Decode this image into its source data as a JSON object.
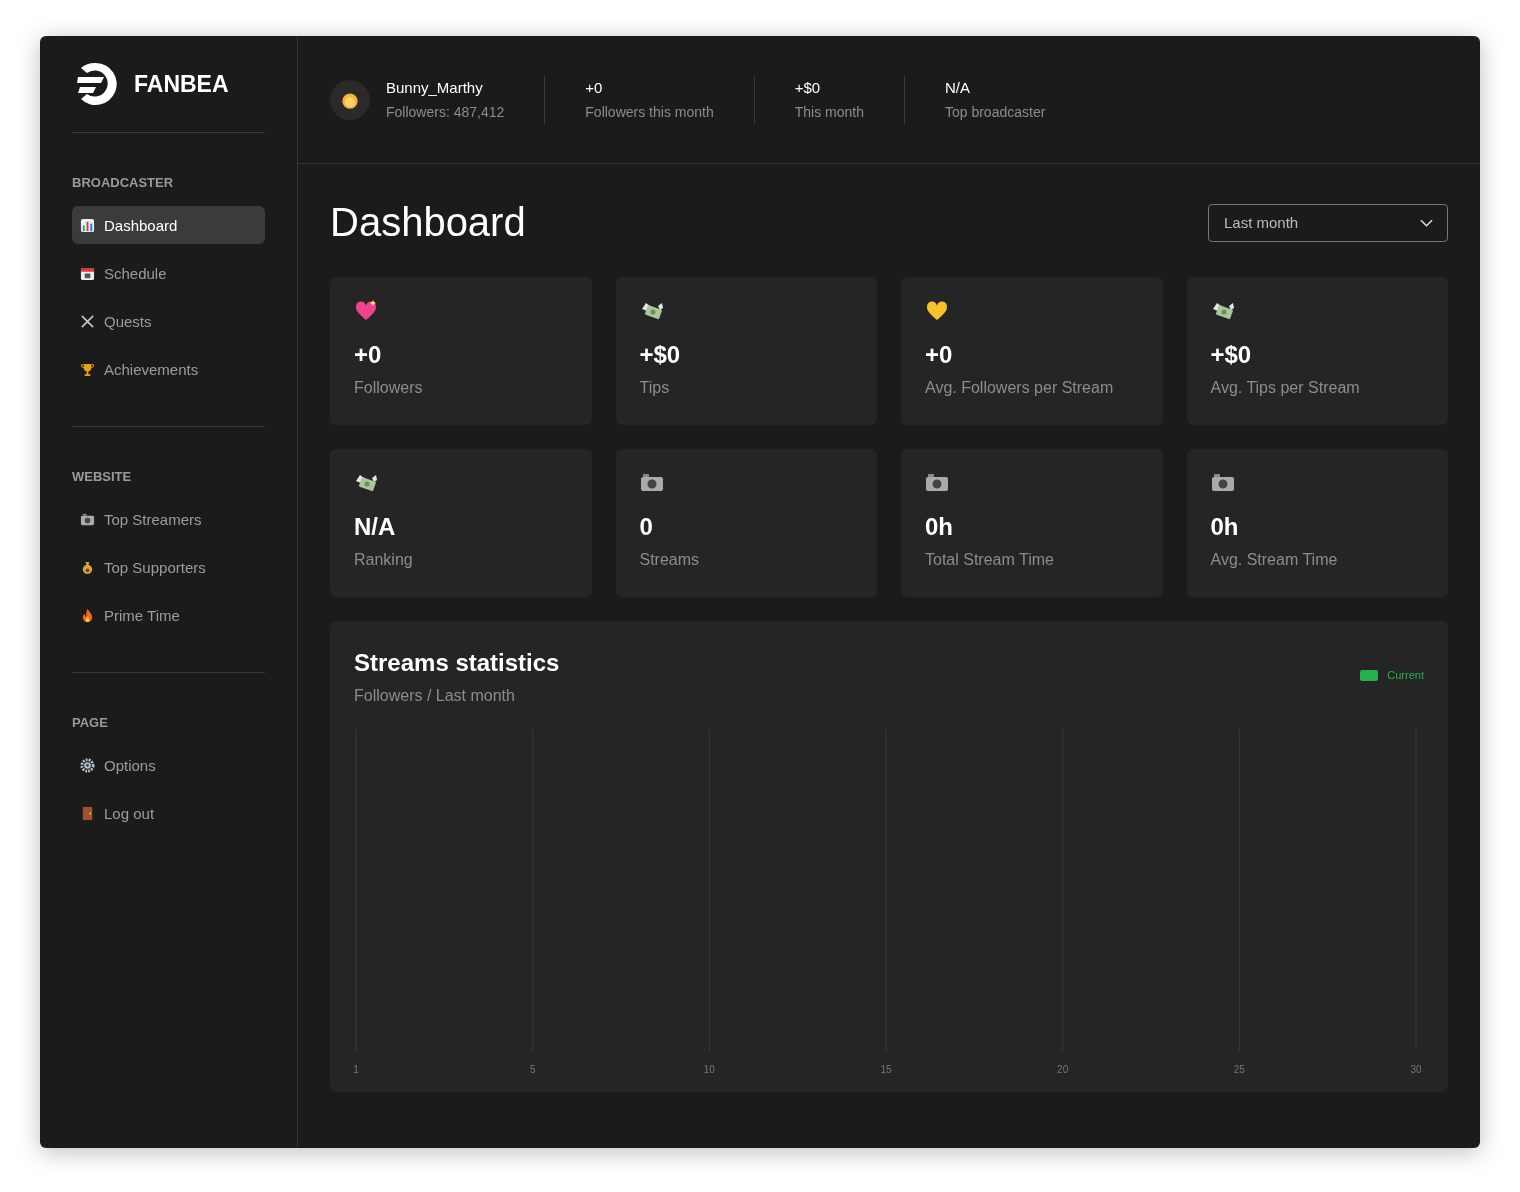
{
  "brand": {
    "name": "FANBEA"
  },
  "sidebar": {
    "sections": [
      {
        "title": "BROADCASTER",
        "items": [
          {
            "label": "Dashboard",
            "selected": true
          },
          {
            "label": "Schedule",
            "selected": false
          },
          {
            "label": "Quests",
            "selected": false
          },
          {
            "label": "Achievements",
            "selected": false
          }
        ]
      },
      {
        "title": "WEBSITE",
        "items": [
          {
            "label": "Top Streamers",
            "selected": false
          },
          {
            "label": "Top Supporters",
            "selected": false
          },
          {
            "label": "Prime Time",
            "selected": false
          }
        ]
      },
      {
        "title": "PAGE",
        "items": [
          {
            "label": "Options",
            "selected": false
          },
          {
            "label": "Log out",
            "selected": false
          }
        ]
      }
    ]
  },
  "header": {
    "user": {
      "name": "Bunny_Marthy",
      "followers": "Followers: 487,412"
    },
    "stats": [
      {
        "value": "+0",
        "label": "Followers this month"
      },
      {
        "value": "+$0",
        "label": "This month"
      },
      {
        "value": "N/A",
        "label": "Top broadcaster"
      }
    ]
  },
  "page": {
    "title": "Dashboard",
    "period": "Last month"
  },
  "cards": [
    {
      "kind": "heart",
      "value": "+0",
      "label": "Followers"
    },
    {
      "kind": "money",
      "value": "+$0",
      "label": "Tips"
    },
    {
      "kind": "goldheart",
      "value": "+0",
      "label": "Avg. Followers per Stream"
    },
    {
      "kind": "money",
      "value": "+$0",
      "label": "Avg. Tips per Stream"
    },
    {
      "kind": "money",
      "value": "N/A",
      "label": "Ranking"
    },
    {
      "kind": "camera",
      "value": "0",
      "label": "Streams"
    },
    {
      "kind": "camera",
      "value": "0h",
      "label": "Total Stream Time"
    },
    {
      "kind": "camera",
      "value": "0h",
      "label": "Avg. Stream Time"
    }
  ],
  "chart": {
    "title": "Streams statistics",
    "subtitle": "Followers / Last month",
    "legend": [
      {
        "name": "Current",
        "color": "#22b14c"
      }
    ],
    "x_labels": [
      "1",
      "5",
      "10",
      "15",
      "20",
      "25",
      "30"
    ]
  }
}
